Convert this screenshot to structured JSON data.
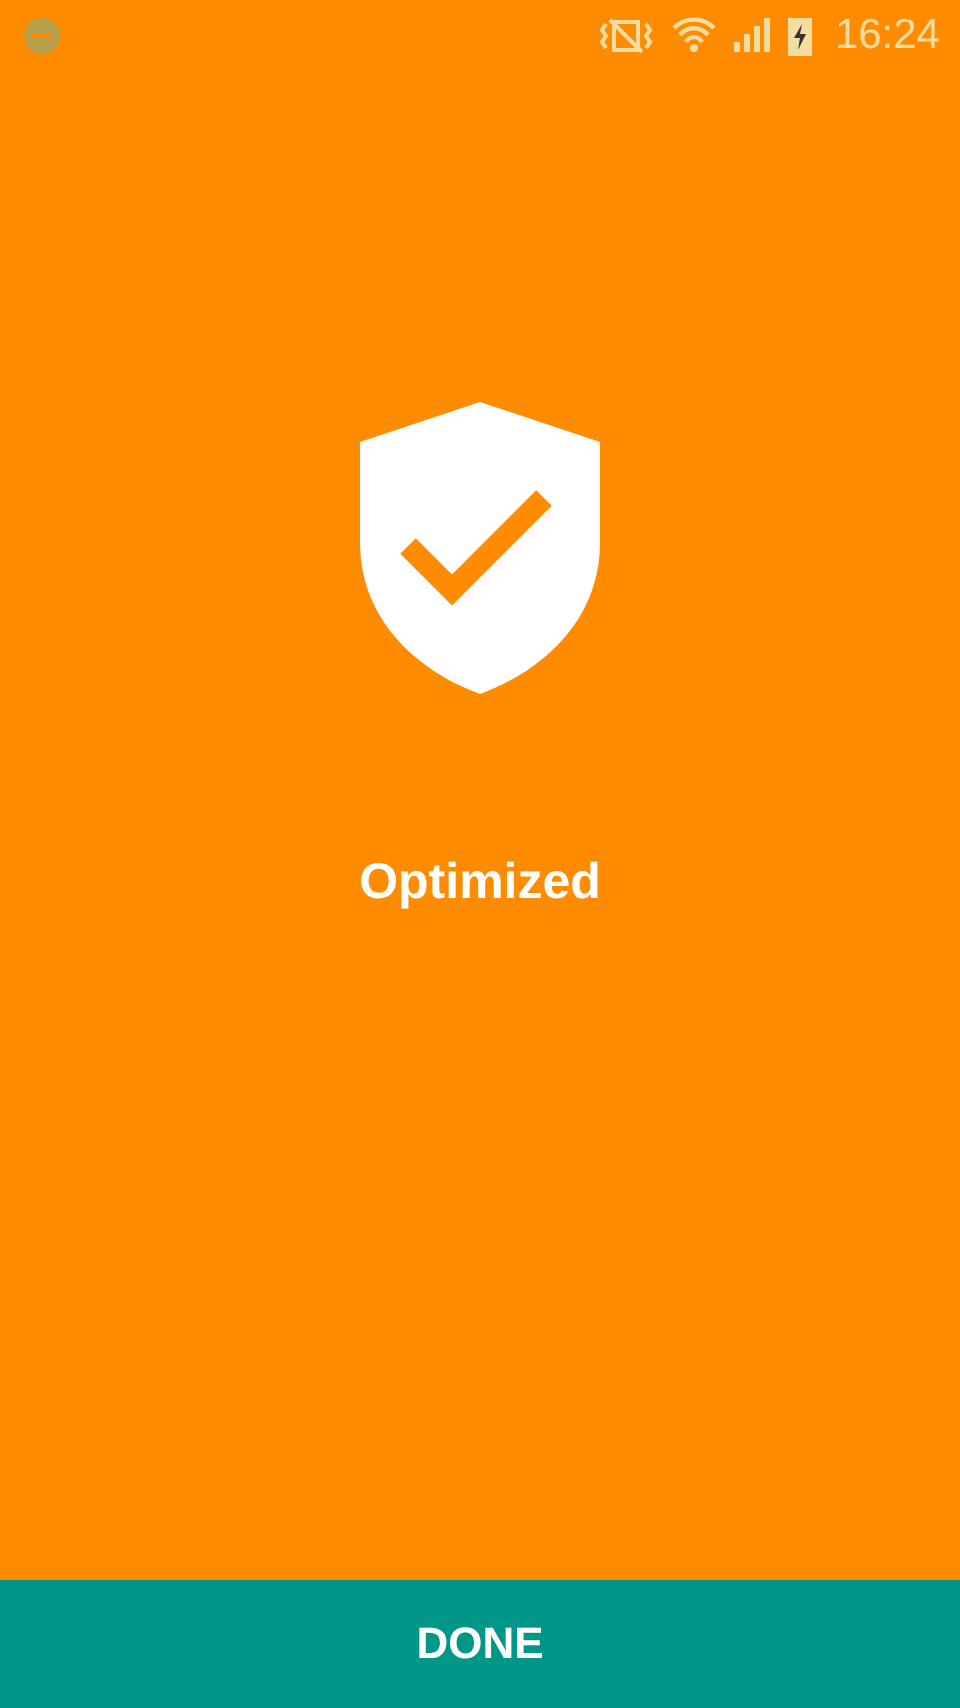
{
  "status_bar": {
    "time": "16:24"
  },
  "result": {
    "title": "Optimized"
  },
  "button": {
    "label": "DONE"
  }
}
